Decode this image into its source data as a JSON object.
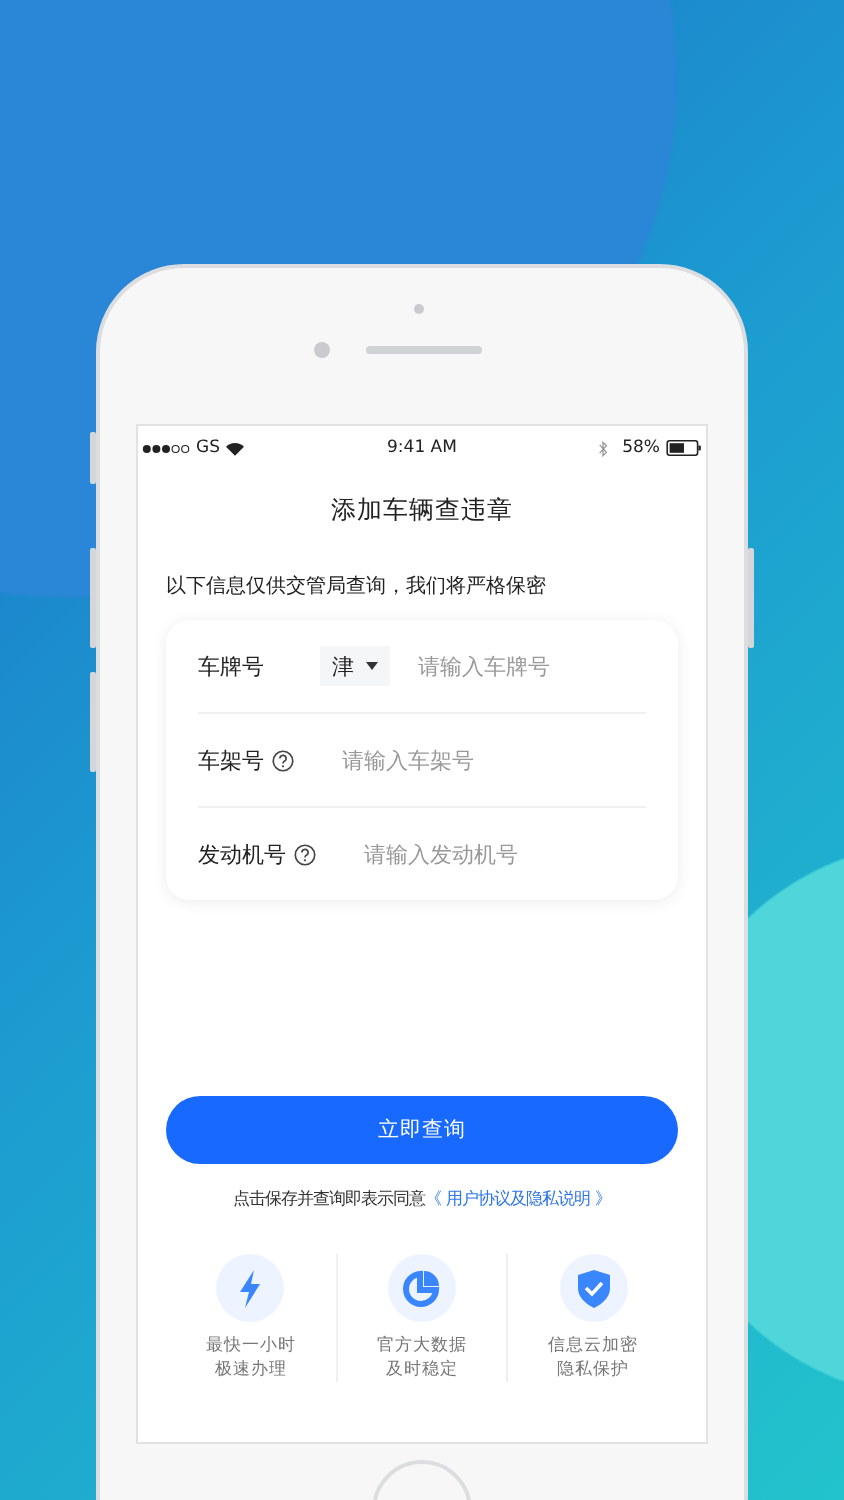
{
  "status_bar": {
    "carrier": "GS",
    "time": "9:41 AM",
    "battery": "58%"
  },
  "title": "添加车辆查违章",
  "notice": "以下信息仅供交管局查询，我们将严格保密",
  "form": [
    {
      "kind": "plate",
      "label": "车牌号",
      "prefix": "津",
      "placeholder": "请输入车牌号"
    },
    {
      "kind": "help",
      "label": "车架号",
      "placeholder": "请输入车架号"
    },
    {
      "kind": "help",
      "label": "发动机号",
      "placeholder": "请输入发动机号"
    }
  ],
  "submit": "立即查询",
  "agreement": {
    "text": "点击保存并查询即表示同意",
    "link": "《 用户协议及隐私说明 》"
  },
  "features": [
    {
      "kind": "speed",
      "lines": [
        "最快一小时",
        "极速办理"
      ]
    },
    {
      "kind": "data",
      "lines": [
        "官方大数据",
        "及时稳定"
      ]
    },
    {
      "kind": "security",
      "lines": [
        "信息云加密",
        "隐私保护"
      ]
    }
  ]
}
